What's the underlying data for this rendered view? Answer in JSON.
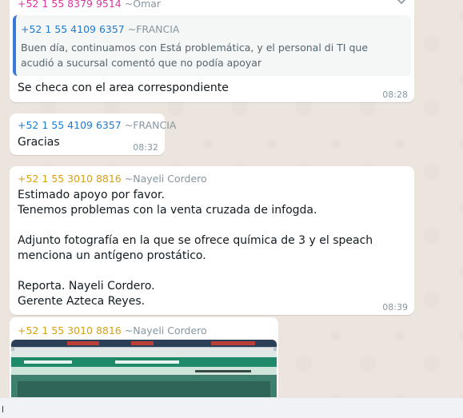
{
  "messages": [
    {
      "id": "m1",
      "sender_phone": "+52 1 55 8379 9514",
      "sender_name": "~Omar",
      "phone_color": "#d83a9e",
      "quote": {
        "phone": "+52 1 55 4109 6357",
        "name": "~FRANCIA",
        "text": "Buen día, continuamos con Está problemática, y el personal di TI que acudió a sucursal comentó que no podía apoyar"
      },
      "text": "Se checa con el area correspondiente",
      "time": "08:28"
    },
    {
      "id": "m2",
      "sender_phone": "+52 1 55 4109 6357",
      "sender_name": "~FRANCIA",
      "phone_color": "#1f7ad1",
      "text": "Gracias",
      "time": "08:32"
    },
    {
      "id": "m3",
      "sender_phone": "+52 1 55 3010 8816",
      "sender_name": "~Nayeli Cordero",
      "phone_color": "#d8a016",
      "text": "Estimado apoyo por favor.\nTenemos problemas con la venta cruzada de infogda.\n\nAdjunto fotografía en la que se ofrece química de 3 y el speach menciona un antígeno prostático.\n\nReporta. Nayeli Cordero.\nGerente Azteca Reyes.",
      "time": "08:39"
    },
    {
      "id": "m4",
      "sender_phone": "+52 1 55 3010 8816",
      "sender_name": "~Nayeli Cordero",
      "phone_color": "#d8a016",
      "image_caption": "photo-of-screen"
    }
  ],
  "colors": {
    "chat_bg": "#ece5dd",
    "bubble_bg": "#ffffff",
    "quote_bar": "#3a7bd5",
    "muted": "#8696a0"
  }
}
